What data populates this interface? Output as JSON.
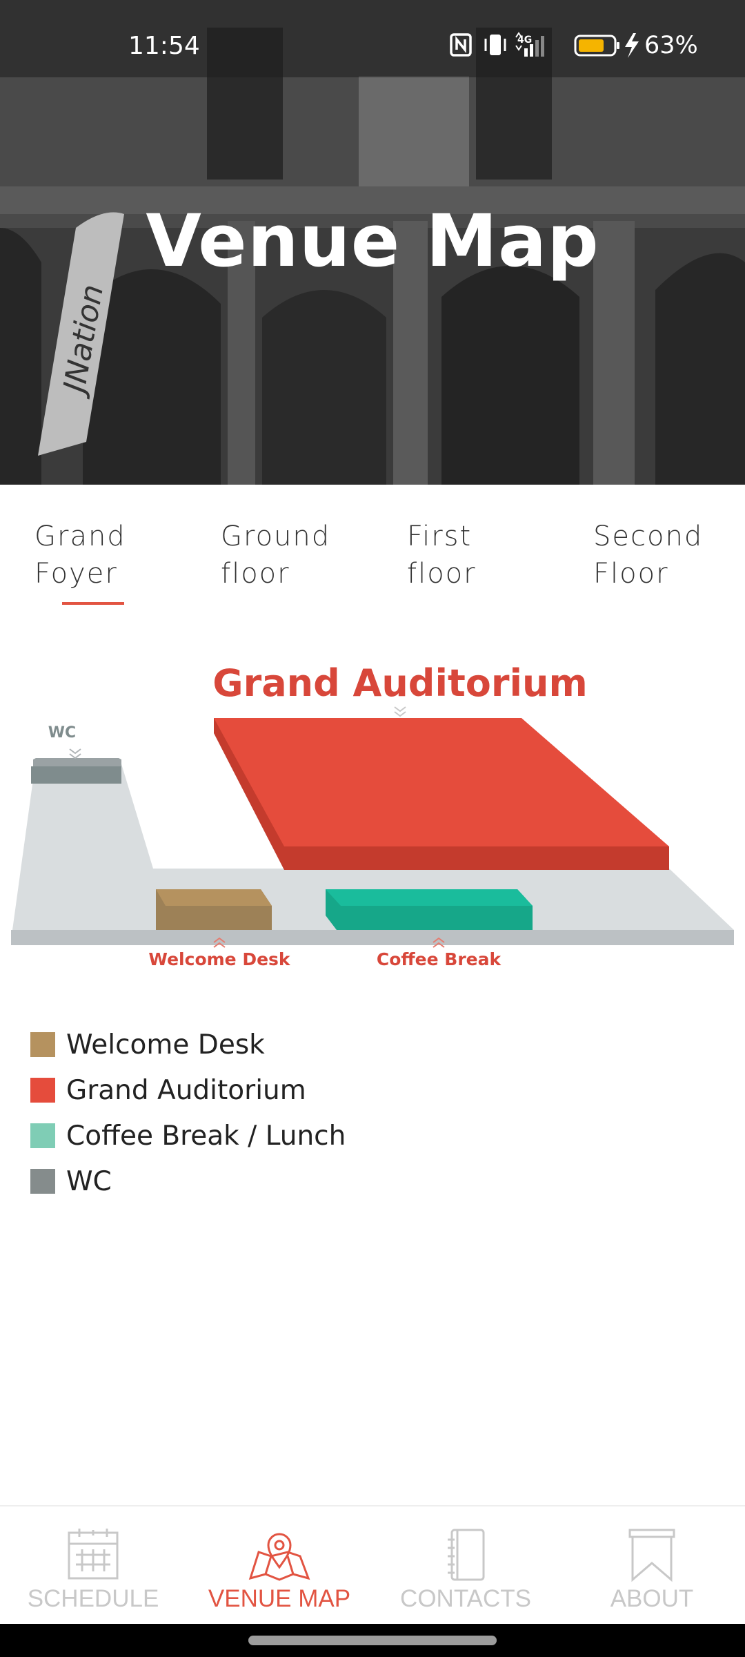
{
  "status_bar": {
    "time": "11:54",
    "battery_percent": "63%",
    "network": "4G",
    "icons": [
      "nfc-icon",
      "vibrate-icon",
      "signal-icon",
      "battery-icon",
      "charging-icon"
    ]
  },
  "header": {
    "title": "Venue Map",
    "background_banner_text": "JNation"
  },
  "tabs": [
    {
      "line1": "Grand",
      "line2": "Foyer",
      "selected": true
    },
    {
      "line1": "Ground",
      "line2": "floor",
      "selected": false
    },
    {
      "line1": "First",
      "line2": "floor",
      "selected": false
    },
    {
      "line1": "Second",
      "line2": "Floor",
      "selected": false
    }
  ],
  "map": {
    "labels": {
      "auditorium": "Grand Auditorium",
      "wc": "WC",
      "welcome_desk": "Welcome Desk",
      "coffee_break": "Coffee Break"
    },
    "colors": {
      "auditorium": "#e54c3c",
      "welcome_desk": "#ad8f62",
      "coffee_break": "#1abc9c",
      "wc": "#7f8c8d",
      "floor": "#d9dddf",
      "label_red": "#d8473a"
    }
  },
  "legend": [
    {
      "label": "Welcome Desk",
      "color": "#b5925f"
    },
    {
      "label": "Grand Auditorium",
      "color": "#e54c3c"
    },
    {
      "label": "Coffee Break / Lunch",
      "color": "#7fcdb5"
    },
    {
      "label": "WC",
      "color": "#858c8c"
    }
  ],
  "bottom_nav": [
    {
      "label": "SCHEDULE",
      "icon": "calendar-icon",
      "active": false
    },
    {
      "label": "VENUE MAP",
      "icon": "map-pin-icon",
      "active": true
    },
    {
      "label": "CONTACTS",
      "icon": "contacts-book-icon",
      "active": false
    },
    {
      "label": "ABOUT",
      "icon": "bookmark-icon",
      "active": false
    }
  ],
  "theme": {
    "accent": "#e25442",
    "inactive_nav": "#c8c8c8"
  }
}
